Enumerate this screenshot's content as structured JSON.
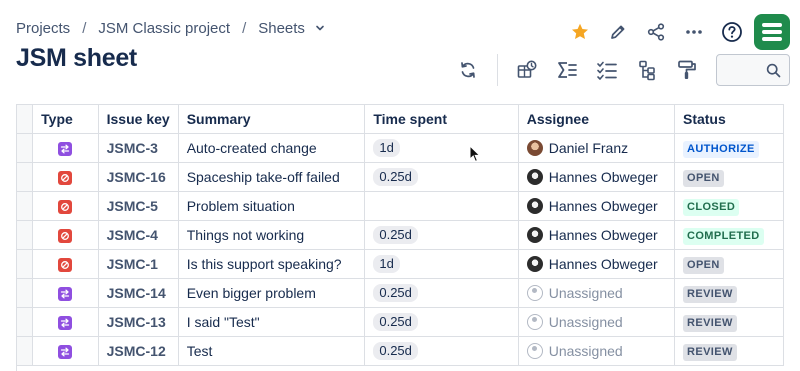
{
  "breadcrumb": {
    "items": [
      "Projects",
      "JSM Classic project",
      "Sheets"
    ],
    "separator": "/"
  },
  "page": {
    "title": "JSM sheet"
  },
  "top_actions": {
    "icons": [
      "star-icon",
      "pencil-icon",
      "share-icon",
      "more-icon",
      "help-icon",
      "app-logo"
    ],
    "star_color": "#f5a623"
  },
  "toolbar": {
    "icons": [
      "refresh-icon",
      "export-icon",
      "sum-icon",
      "checklist-icon",
      "hierarchy-icon",
      "paint-roller-icon"
    ],
    "search_value": "",
    "search_placeholder": ""
  },
  "table": {
    "columns": [
      "Type",
      "Issue key",
      "Summary",
      "Time spent",
      "Assignee",
      "Status"
    ],
    "rows": [
      {
        "type": "change",
        "key": "JSMC-3",
        "summary": "Auto-created change",
        "time": "1d",
        "assignee": "Daniel Franz",
        "avatar": "daniel",
        "status": "AUTHORIZE",
        "status_style": "blue"
      },
      {
        "type": "incident",
        "key": "JSMC-16",
        "summary": "Spaceship take-off failed",
        "time": "0.25d",
        "assignee": "Hannes Obweger",
        "avatar": "hannes",
        "status": "OPEN",
        "status_style": "grey"
      },
      {
        "type": "incident",
        "key": "JSMC-5",
        "summary": "Problem situation",
        "time": "",
        "assignee": "Hannes Obweger",
        "avatar": "hannes",
        "status": "CLOSED",
        "status_style": "green"
      },
      {
        "type": "incident",
        "key": "JSMC-4",
        "summary": "Things not working",
        "time": "0.25d",
        "assignee": "Hannes Obweger",
        "avatar": "hannes",
        "status": "COMPLETED",
        "status_style": "green"
      },
      {
        "type": "incident",
        "key": "JSMC-1",
        "summary": "Is this support speaking?",
        "time": "1d",
        "assignee": "Hannes Obweger",
        "avatar": "hannes",
        "status": "OPEN",
        "status_style": "grey"
      },
      {
        "type": "change",
        "key": "JSMC-14",
        "summary": "Even bigger problem",
        "time": "0.25d",
        "assignee": "Unassigned",
        "avatar": "none",
        "status": "REVIEW",
        "status_style": "grey"
      },
      {
        "type": "change",
        "key": "JSMC-13",
        "summary": "I said \"Test\"",
        "time": "0.25d",
        "assignee": "Unassigned",
        "avatar": "none",
        "status": "REVIEW",
        "status_style": "grey"
      },
      {
        "type": "change",
        "key": "JSMC-12",
        "summary": "Test",
        "time": "0.25d",
        "assignee": "Unassigned",
        "avatar": "none",
        "status": "REVIEW",
        "status_style": "grey"
      }
    ]
  },
  "colors": {
    "change_type": "#8f4fe0",
    "incident_type": "#e2483d",
    "status_blue_bg": "#e9f2ff",
    "status_grey_bg": "#dfe1e6",
    "status_green_bg": "#dcfff1",
    "logo_green": "#1f8b4c"
  }
}
